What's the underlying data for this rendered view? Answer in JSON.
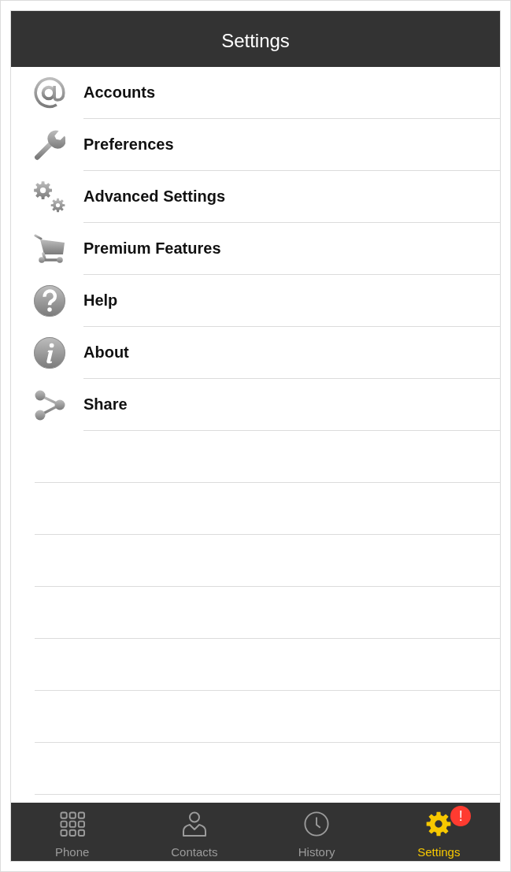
{
  "header": {
    "title": "Settings"
  },
  "menu_items": [
    {
      "label": "Accounts"
    },
    {
      "label": "Preferences"
    },
    {
      "label": "Advanced Settings"
    },
    {
      "label": "Premium Features"
    },
    {
      "label": "Help"
    },
    {
      "label": "About"
    },
    {
      "label": "Share"
    }
  ],
  "tab_bar": {
    "tabs": [
      {
        "label": "Phone",
        "selected": false
      },
      {
        "label": "Contacts",
        "selected": false
      },
      {
        "label": "History",
        "selected": false
      },
      {
        "label": "Settings",
        "selected": true,
        "badge": "!"
      }
    ]
  }
}
